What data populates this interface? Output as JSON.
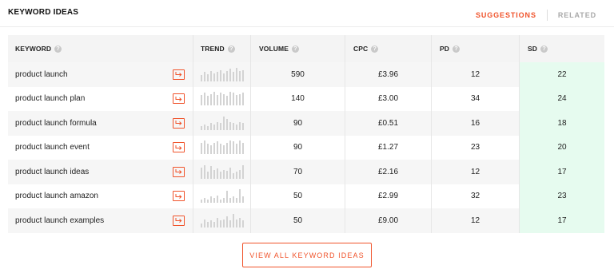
{
  "header": {
    "title": "KEYWORD IDEAS",
    "tabs": [
      {
        "label": "SUGGESTIONS",
        "active": true
      },
      {
        "label": "RELATED",
        "active": false
      }
    ]
  },
  "table": {
    "columns": [
      "KEYWORD",
      "TREND",
      "VOLUME",
      "CPC",
      "PD",
      "SD"
    ],
    "rows": [
      {
        "keyword": "product launch",
        "volume": "590",
        "cpc": "£3.96",
        "pd": "12",
        "sd": "22",
        "trend": [
          6,
          9,
          7,
          10,
          8,
          9,
          11,
          8,
          10,
          12,
          9,
          13,
          10,
          11
        ]
      },
      {
        "keyword": "product launch plan",
        "volume": "140",
        "cpc": "£3.00",
        "pd": "34",
        "sd": "24",
        "trend": [
          10,
          12,
          9,
          11,
          13,
          10,
          12,
          11,
          9,
          13,
          12,
          10,
          11,
          12
        ]
      },
      {
        "keyword": "product launch formula",
        "volume": "90",
        "cpc": "£0.51",
        "pd": "16",
        "sd": "18",
        "trend": [
          3,
          4,
          3,
          5,
          4,
          6,
          5,
          10,
          8,
          6,
          5,
          4,
          6,
          5
        ]
      },
      {
        "keyword": "product launch event",
        "volume": "90",
        "cpc": "£1.27",
        "pd": "23",
        "sd": "20",
        "trend": [
          10,
          12,
          9,
          8,
          10,
          11,
          9,
          8,
          10,
          12,
          11,
          9,
          12,
          10
        ]
      },
      {
        "keyword": "product launch ideas",
        "volume": "70",
        "cpc": "£2.16",
        "pd": "12",
        "sd": "17",
        "trend": [
          10,
          12,
          6,
          11,
          8,
          9,
          6,
          8,
          7,
          10,
          5,
          6,
          8,
          12
        ]
      },
      {
        "keyword": "product launch amazon",
        "volume": "50",
        "cpc": "£2.99",
        "pd": "32",
        "sd": "23",
        "trend": [
          2,
          3,
          2,
          4,
          3,
          5,
          2,
          3,
          8,
          3,
          4,
          3,
          9,
          4
        ]
      },
      {
        "keyword": "product launch examples",
        "volume": "50",
        "cpc": "£9.00",
        "pd": "12",
        "sd": "17",
        "trend": [
          3,
          6,
          4,
          5,
          4,
          7,
          5,
          6,
          8,
          5,
          10,
          6,
          7,
          5
        ]
      }
    ]
  },
  "footer": {
    "view_all_label": "VIEW ALL KEYWORD IDEAS"
  },
  "colors": {
    "accent": "#f0532b",
    "sd_highlight": "#e6fbef",
    "muted_tab": "#a8a8a8"
  },
  "icons": {
    "help": "question-circle-icon",
    "action": "arrow-turn-right-icon"
  }
}
